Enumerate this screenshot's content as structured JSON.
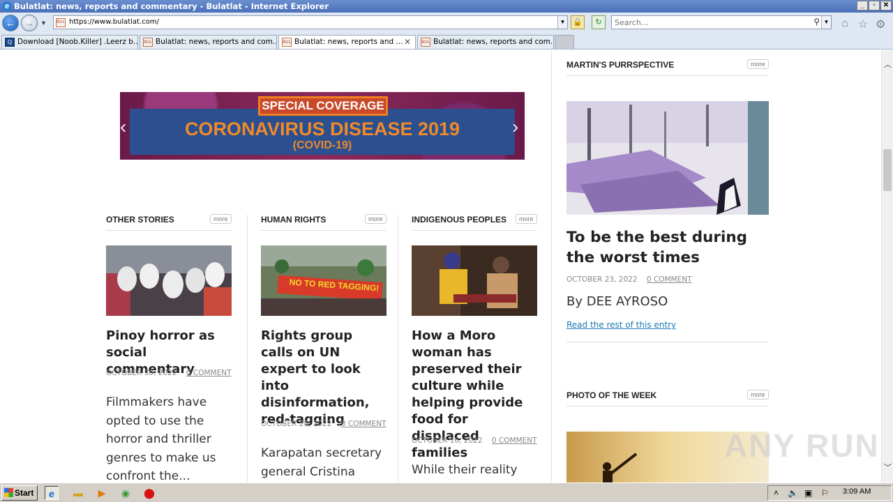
{
  "window": {
    "title": "Bulatlat: news, reports and commentary - Bulatlat - Internet Explorer",
    "controls": [
      "_",
      "▫",
      "✕"
    ]
  },
  "address_bar": {
    "url": "https://www.bulatlat.com/",
    "search_placeholder": "Search..."
  },
  "tabs": [
    {
      "label": "Download [Noob.Killer] .Leerz b...",
      "active": false
    },
    {
      "label": "Bulatlat: news, reports and com...",
      "active": false
    },
    {
      "label": "Bulatlat: news, reports and ...",
      "active": true
    },
    {
      "label": "Bulatlat: news, reports and com...",
      "active": false
    }
  ],
  "banner": {
    "tag": "SPECIAL COVERAGE",
    "headline": "CORONAVIRUS DISEASE 2019",
    "sub": "(COVID-19)"
  },
  "sections": [
    {
      "heading": "OTHER STORIES",
      "more": "more",
      "title": "Pinoy horror as social commentary",
      "date": "OCTOBER 30, 2022",
      "comments": "0 COMMENT",
      "excerpt": "Filmmakers have opted to use the horror and thriller genres to make us confront the..."
    },
    {
      "heading": "HUMAN RIGHTS",
      "more": "more",
      "title": "Rights group calls on UN expert to look into disinformation, red-tagging",
      "date": "OCTOBER 28, 2022",
      "comments": "0 COMMENT",
      "excerpt": "Karapatan secretary general Cristina",
      "image_text": "NO TO RED TAGGING!"
    },
    {
      "heading": "INDIGENOUS PEOPLES",
      "more": "more",
      "title": "How a Moro woman has preserved their culture while helping provide food for displaced families",
      "date": "OCTOBER 16, 2022",
      "comments": "0 COMMENT",
      "excerpt": "While their reality"
    }
  ],
  "sidebar": {
    "purrspective": {
      "heading": "MARTIN'S PURRSPECTIVE",
      "more": "more",
      "title": "To be the best during the worst times",
      "date": "OCTOBER 23, 2022",
      "comments": "0 COMMENT",
      "byline": "By DEE AYROSO",
      "readmore": "Read the rest of this entry"
    },
    "photo": {
      "heading": "PHOTO OF THE WEEK",
      "more": "more"
    }
  },
  "watermark": "ANY RUN",
  "taskbar": {
    "start": "Start",
    "clock": "3:09 AM"
  }
}
